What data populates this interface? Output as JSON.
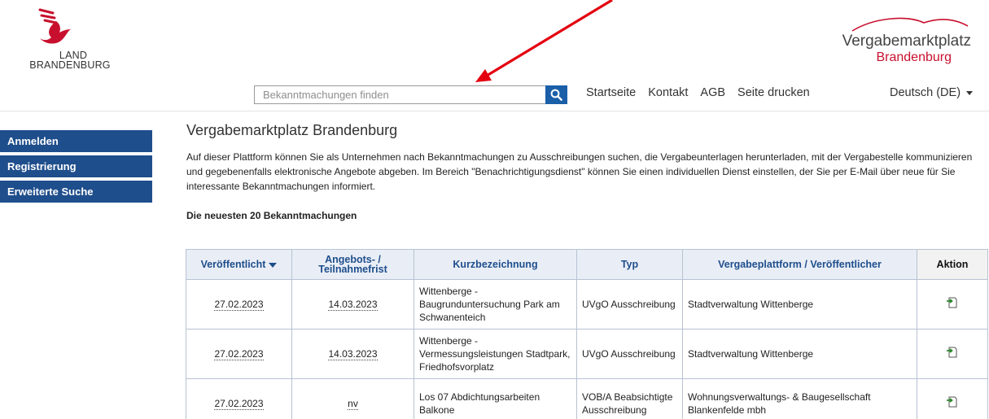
{
  "logo": {
    "line1": "LAND",
    "line2": "BRANDENBURG"
  },
  "brand": {
    "name": "Vergabemarktplatz",
    "region": "Brandenburg"
  },
  "search": {
    "placeholder": "Bekanntmachungen finden",
    "value": ""
  },
  "topnav": [
    "Startseite",
    "Kontakt",
    "AGB",
    "Seite drucken"
  ],
  "language": "Deutsch (DE)",
  "sidebar": [
    "Anmelden",
    "Registrierung",
    "Erweiterte Suche"
  ],
  "main": {
    "title": "Vergabemarktplatz Brandenburg",
    "intro": "Auf dieser Plattform können Sie als Unternehmen nach Bekanntmachungen zu Ausschreibungen suchen, die Vergabeunterlagen herunterladen, mit der Vergabestelle kommunizieren und gegebenenfalls elektronische Angebote abgeben. Im Bereich \"Benachrichtigungsdienst\" können Sie einen individuellen Dienst einstellen, der Sie per E-Mail über neue für Sie interessante Bekanntmachungen informiert.",
    "table_heading": "Die neuesten 20 Bekanntmachungen"
  },
  "table": {
    "columns": {
      "published": "Veröffentlicht",
      "deadline_line1": "Angebots- /",
      "deadline_line2": "Teilnahmefrist",
      "title": "Kurzbezeichnung",
      "type": "Typ",
      "platform": "Vergabeplattform / Veröffentlicher",
      "action": "Aktion"
    },
    "rows": [
      {
        "published": "27.02.2023",
        "deadline": "14.03.2023",
        "title": "Wittenberge - Baugrunduntersuchung Park am Schwanenteich",
        "type": "UVgO Ausschreibung",
        "platform": "Stadtverwaltung Wittenberge"
      },
      {
        "published": "27.02.2023",
        "deadline": "14.03.2023",
        "title": "Wittenberge - Vermessungsleistungen Stadtpark, Friedhofsvorplatz",
        "type": "UVgO Ausschreibung",
        "platform": "Stadtverwaltung Wittenberge"
      },
      {
        "published": "27.02.2023",
        "deadline": "nv",
        "title": "Los 07 Abdichtungsarbeiten Balkone",
        "type": "VOB/A Beabsichtigte Ausschreibung",
        "platform": "Wohnungsverwaltungs- & Baugesellschaft Blankenfelde mbh"
      }
    ]
  },
  "colors": {
    "nav_blue": "#1f4e8c",
    "search_button": "#1a5fa8",
    "brand_red": "#c8102e",
    "annotation_arrow": "#e3000f"
  }
}
